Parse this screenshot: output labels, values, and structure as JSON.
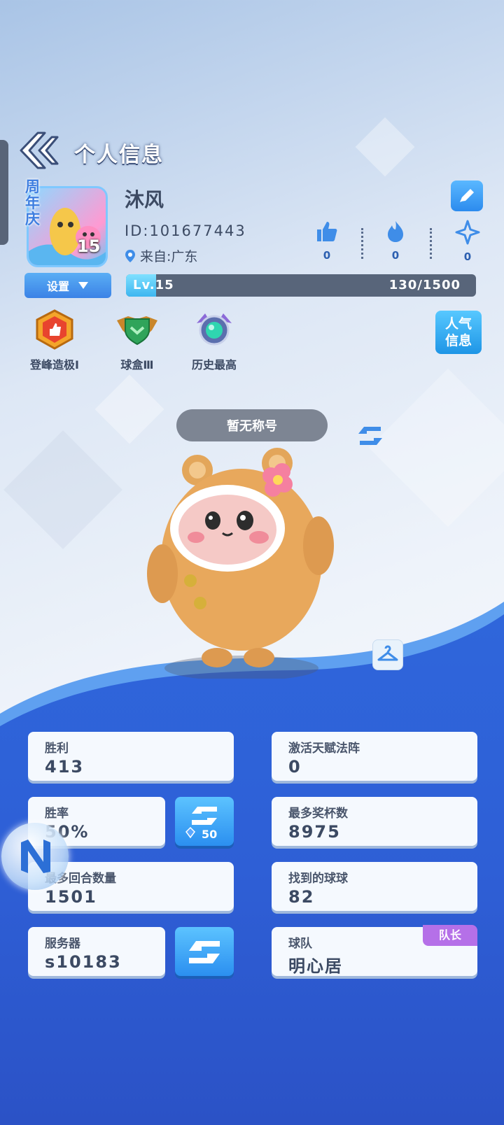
{
  "header": {
    "title": "个人信息"
  },
  "profile": {
    "avatar_tag": "周年庆",
    "avatar_level": "15",
    "settings_label": "设置",
    "name": "沐风",
    "uid": "ID:101677443",
    "location": "来自:广东",
    "level_label": "Lv.15",
    "exp_text": "130/1500",
    "exp_fraction": 0.0867
  },
  "stats": {
    "likes": "0",
    "fire": "0",
    "stars": "0"
  },
  "badges": [
    {
      "label": "登峰造极Ⅰ",
      "icon": "crown-badge-icon"
    },
    {
      "label": "球盒Ⅲ",
      "icon": "green-shield-badge-icon"
    },
    {
      "label": "历史最高",
      "icon": "gem-badge-icon"
    }
  ],
  "popularity_button": {
    "line1": "人气",
    "line2": "信息"
  },
  "player_title": "暂无称号",
  "records": {
    "wins": {
      "label": "胜利",
      "value": "413"
    },
    "talent": {
      "label": "激活天赋法阵",
      "value": "0"
    },
    "win_rate": {
      "label": "胜率",
      "value": "50%"
    },
    "trophies": {
      "label": "最多奖杯数",
      "value": "8975"
    },
    "rounds": {
      "label": "最多回合数量",
      "value": "1501"
    },
    "balls": {
      "label": "找到的球球",
      "value": "82"
    },
    "server": {
      "label": "服务器",
      "value": "s10183"
    },
    "team": {
      "label": "球队",
      "value": "明心居",
      "role": "队长"
    }
  },
  "refresh_cost": "50",
  "colors": {
    "accent": "#2b8ff0",
    "wave": "#2c5fd8",
    "captain": "#b570e8"
  }
}
